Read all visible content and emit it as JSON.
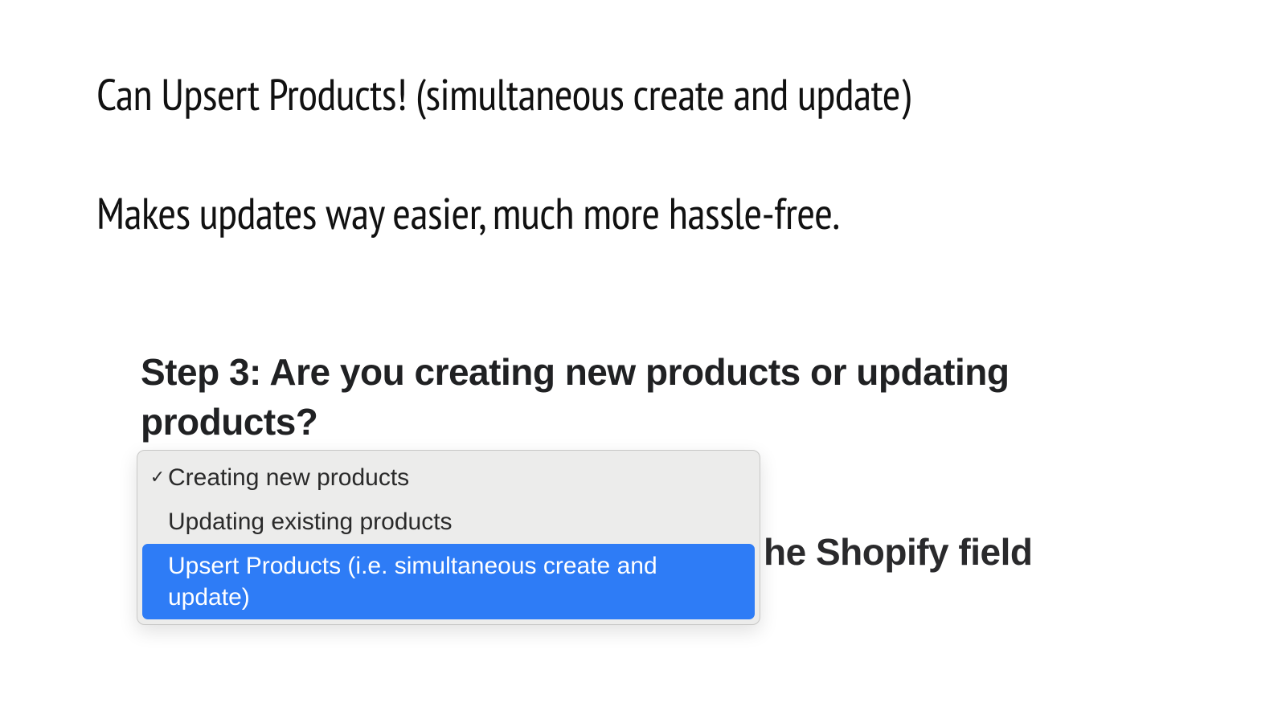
{
  "headlines": {
    "line1": "Can Upsert Products! (simultaneous create and update)",
    "line2": "Makes updates way easier, much more hassle-free."
  },
  "step": {
    "heading": "Step 3: Are you creating new products or updating products?"
  },
  "dropdown": {
    "options": [
      {
        "label": "Creating new products",
        "checked": true,
        "highlighted": false
      },
      {
        "label": "Updating existing products",
        "checked": false,
        "highlighted": false
      },
      {
        "label": "Upsert Products (i.e. simultaneous create and update)",
        "checked": false,
        "highlighted": true
      }
    ],
    "check_glyph": "✓"
  },
  "background_text": {
    "partial": "he Shopify field"
  },
  "colors": {
    "highlight_bg": "#2e7cf6",
    "menu_bg": "#ececeb",
    "text_dark": "#202123"
  }
}
